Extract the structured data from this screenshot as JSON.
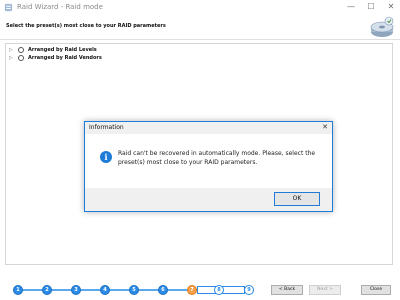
{
  "window": {
    "title": "Raid Wizard - Raid mode",
    "controls": {
      "minimize": "—",
      "maximize": "☐",
      "close": "✕"
    }
  },
  "header": {
    "instruction": "Select the preset(s) most close to your RAID parameters"
  },
  "tree": {
    "items": [
      {
        "label": "Arranged by Raid Levels"
      },
      {
        "label": "Arranged by Raid Vendors"
      }
    ]
  },
  "dialog": {
    "title": "Information",
    "close": "✕",
    "icon": "i",
    "message": "Raid can't be recovered in automatically mode. Please, select the preset(s) most close to your RAID parameters.",
    "ok_label": "OK"
  },
  "steps": {
    "labels": [
      "1",
      "2",
      "3",
      "4",
      "5",
      "6",
      "7",
      "8",
      "9"
    ],
    "current": "7"
  },
  "nav": {
    "back_label": "< Back",
    "next_label": "Next >",
    "close_label": "Close"
  },
  "colors": {
    "accent": "#1e7bd6",
    "step_done": "#2b8be6",
    "step_current": "#f2a04a"
  }
}
